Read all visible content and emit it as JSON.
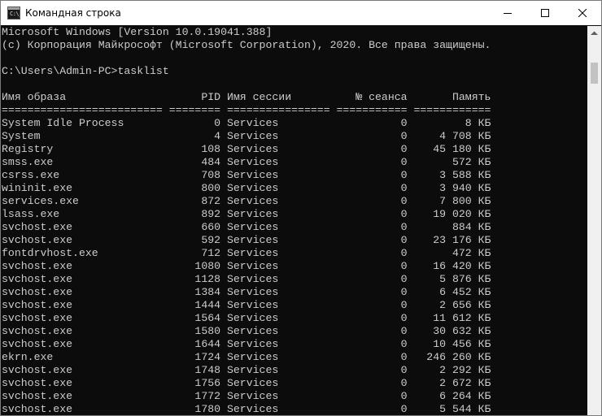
{
  "window": {
    "title": "Командная строка",
    "app_icon_text": "C:\\_",
    "icons": {
      "app": "cmd-icon",
      "minimize": "minimize-icon",
      "maximize": "maximize-icon",
      "close": "close-icon",
      "scroll_up": "scroll-up-arrow-icon"
    }
  },
  "console": {
    "banner_line1": "Microsoft Windows [Version 10.0.19041.388]",
    "banner_line2": "(c) Корпорация Майкрософт (Microsoft Corporation), 2020. Все права защищены.",
    "prompt": "C:\\Users\\Admin-PC>",
    "command": "tasklist",
    "header": "Имя образа                     PID Имя сессии          № сеанса       Память",
    "separator": "========================= ======== ================ =========== ============",
    "rows": [
      "System Idle Process              0 Services                   0         8 КБ",
      "System                           4 Services                   0     4 708 КБ",
      "Registry                       108 Services                   0    45 180 КБ",
      "smss.exe                       484 Services                   0       572 КБ",
      "csrss.exe                      708 Services                   0     3 588 КБ",
      "wininit.exe                    800 Services                   0     3 940 КБ",
      "services.exe                   872 Services                   0     7 800 КБ",
      "lsass.exe                      892 Services                   0    19 020 КБ",
      "svchost.exe                    660 Services                   0       884 КБ",
      "svchost.exe                    592 Services                   0    23 176 КБ",
      "fontdrvhost.exe                712 Services                   0       472 КБ",
      "svchost.exe                   1080 Services                   0    16 420 КБ",
      "svchost.exe                   1128 Services                   0     5 876 КБ",
      "svchost.exe                   1384 Services                   0     6 452 КБ",
      "svchost.exe                   1444 Services                   0     2 656 КБ",
      "svchost.exe                   1564 Services                   0    11 612 КБ",
      "svchost.exe                   1580 Services                   0    30 632 КБ",
      "svchost.exe                   1644 Services                   0    10 456 КБ",
      "ekrn.exe                      1724 Services                   0   246 260 КБ",
      "svchost.exe                   1748 Services                   0     2 292 КБ",
      "svchost.exe                   1756 Services                   0     2 672 КБ",
      "svchost.exe                   1772 Services                   0     6 264 КБ",
      "svchost.exe                   1780 Services                   0     5 544 КБ"
    ]
  },
  "colors": {
    "console_bg": "#0c0c0c",
    "console_text": "#cccccc",
    "titlebar_bg": "#ffffff"
  }
}
